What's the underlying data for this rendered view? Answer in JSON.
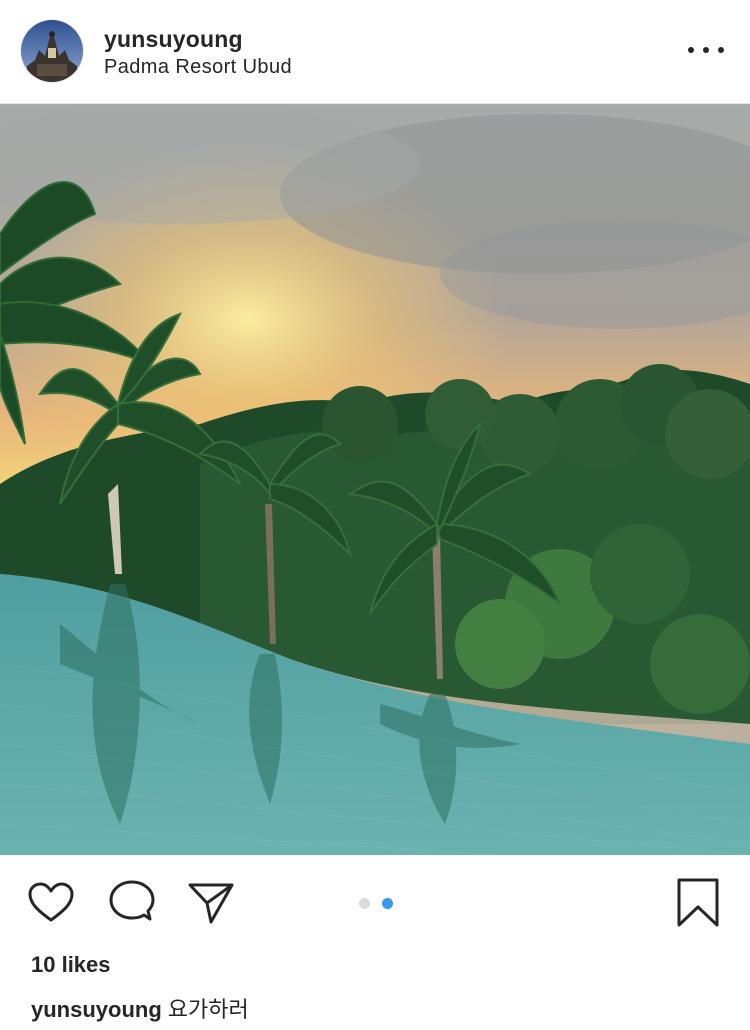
{
  "post": {
    "username": "yunsuyoung",
    "location": "Padma Resort Ubud",
    "likes": "10 likes",
    "caption_user": "yunsuyoung",
    "caption_text": "요가하러"
  },
  "carousel": {
    "current": 2,
    "total": 2
  },
  "icons": {
    "more": "more-options-icon",
    "like": "heart-icon",
    "comment": "comment-bubble-icon",
    "share": "paper-plane-icon",
    "save": "bookmark-icon"
  },
  "colors": {
    "text": "#262626",
    "dot_active": "#3897f0",
    "dot_inactive": "#dbdbdb"
  }
}
